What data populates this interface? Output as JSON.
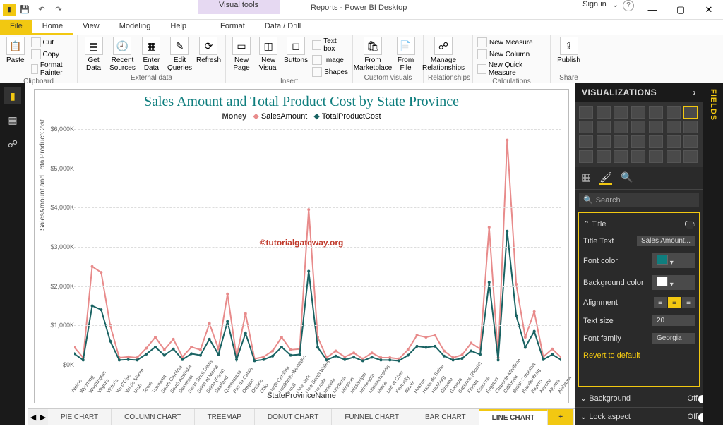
{
  "app": {
    "title": "Reports - Power BI Desktop",
    "visual_tools": "Visual tools",
    "sign_in": "Sign in"
  },
  "tabs": {
    "file": "File",
    "home": "Home",
    "view": "View",
    "modeling": "Modeling",
    "help": "Help",
    "format": "Format",
    "datadrill": "Data / Drill"
  },
  "ribbon": {
    "clipboard": {
      "paste": "Paste",
      "cut": "Cut",
      "copy": "Copy",
      "fp": "Format Painter",
      "label": "Clipboard"
    },
    "external": {
      "getdata": "Get\nData",
      "recent": "Recent\nSources",
      "enter": "Enter\nData",
      "edit": "Edit\nQueries",
      "refresh": "Refresh",
      "label": "External data"
    },
    "insert": {
      "newpage": "New\nPage",
      "newvisual": "New\nVisual",
      "buttons": "Buttons",
      "textbox": "Text box",
      "image": "Image",
      "shapes": "Shapes",
      "label": "Insert"
    },
    "custom": {
      "market": "From\nMarketplace",
      "file": "From\nFile",
      "label": "Custom visuals"
    },
    "rel": {
      "manage": "Manage\nRelationships",
      "label": "Relationships"
    },
    "calc": {
      "nm": "New Measure",
      "nc": "New Column",
      "nqm": "New Quick Measure",
      "label": "Calculations"
    },
    "share": {
      "publish": "Publish",
      "label": "Share"
    }
  },
  "chart_data": {
    "type": "line",
    "title": "Sales Amount and Total Product Cost by State Province",
    "watermark": "©tutorialgateway.org",
    "legend_lead": "Money",
    "xlabel": "StateProvinceName",
    "ylabel": "SalesAmount and TotalProductCost",
    "ylim": [
      0,
      6000
    ],
    "yticks": [
      "$0K",
      "$1,000K",
      "$2,000K",
      "$3,000K",
      "$4,000K",
      "$5,000K",
      "$6,000K"
    ],
    "categories": [
      "Yveline",
      "Wyoming",
      "Washington",
      "Virginia",
      "Victoria",
      "Val d'Oise",
      "Val de Marne",
      "Utah",
      "Texas",
      "Tasmania",
      "South Carolina",
      "South Australia",
      "Somerset",
      "Seine Saint Denis",
      "Seine et Marne",
      "Seine (Paris)",
      "Saarland",
      "Queensland",
      "Pas de Calais",
      "Oregon",
      "Ontario",
      "Ohio",
      "North Carolina",
      "Nordrhein-Westfalen",
      "Nord",
      "New York",
      "New South Wales",
      "Nevada",
      "Moselle",
      "Montana",
      "Missouri",
      "Mississippi",
      "Minnesota",
      "Massachusetts",
      "Maine",
      "Loir et Cher",
      "Kentucky",
      "Illinois",
      "Hessen",
      "Hauts de Seine",
      "Hamburg",
      "Gironde",
      "Georgia",
      "Garonne (Haute)",
      "Florida",
      "Essonne",
      "England",
      "Charente-Maritime",
      "California",
      "British Columbia",
      "Brandenburg",
      "Bayern",
      "Arizona",
      "Alberta",
      "Alabama"
    ],
    "series": [
      {
        "name": "SalesAmount",
        "color": "#e88b8b",
        "values": [
          450,
          180,
          2500,
          2350,
          1000,
          180,
          200,
          180,
          420,
          700,
          380,
          650,
          200,
          450,
          380,
          1050,
          400,
          1800,
          200,
          1300,
          150,
          200,
          350,
          700,
          380,
          400,
          3950,
          700,
          180,
          350,
          200,
          300,
          150,
          300,
          180,
          180,
          150,
          380,
          750,
          700,
          750,
          350,
          180,
          250,
          550,
          400,
          3500,
          180,
          5720,
          2050,
          700,
          1350,
          200,
          400,
          180
        ]
      },
      {
        "name": "TotalProductCost",
        "color": "#1a6363",
        "values": [
          280,
          120,
          1500,
          1400,
          600,
          120,
          130,
          120,
          270,
          450,
          240,
          400,
          130,
          280,
          240,
          650,
          260,
          1100,
          130,
          800,
          100,
          130,
          220,
          450,
          240,
          260,
          2380,
          440,
          120,
          220,
          130,
          190,
          100,
          190,
          120,
          120,
          100,
          240,
          470,
          440,
          470,
          220,
          120,
          160,
          350,
          260,
          2100,
          120,
          3400,
          1250,
          440,
          850,
          130,
          260,
          120
        ]
      }
    ]
  },
  "sheets": {
    "nav_prev": "◀",
    "nav_next": "▶",
    "tabs": [
      "PIE CHART",
      "COLUMN CHART",
      "TREEMAP",
      "DONUT CHART",
      "FUNNEL CHART",
      "BAR CHART",
      "LINE CHART"
    ],
    "active": "LINE CHART",
    "add": "+"
  },
  "vis": {
    "header": "VISUALIZATIONS",
    "search": "Search",
    "title_section": "Title",
    "title_on": "On",
    "title_text_label": "Title Text",
    "title_text_value": "Sales Amount...",
    "font_color": "Font color",
    "font_color_value": "#0f7e7e",
    "bg_color": "Background color",
    "bg_color_value": "#ffffff",
    "alignment": "Alignment",
    "text_size": "Text size",
    "text_size_value": "20",
    "font_family": "Font family",
    "font_family_value": "Georgia",
    "revert": "Revert to default",
    "background": "Background",
    "background_state": "Off",
    "lock": "Lock aspect",
    "lock_state": "Off"
  },
  "fields": {
    "label": "FIELDS"
  }
}
